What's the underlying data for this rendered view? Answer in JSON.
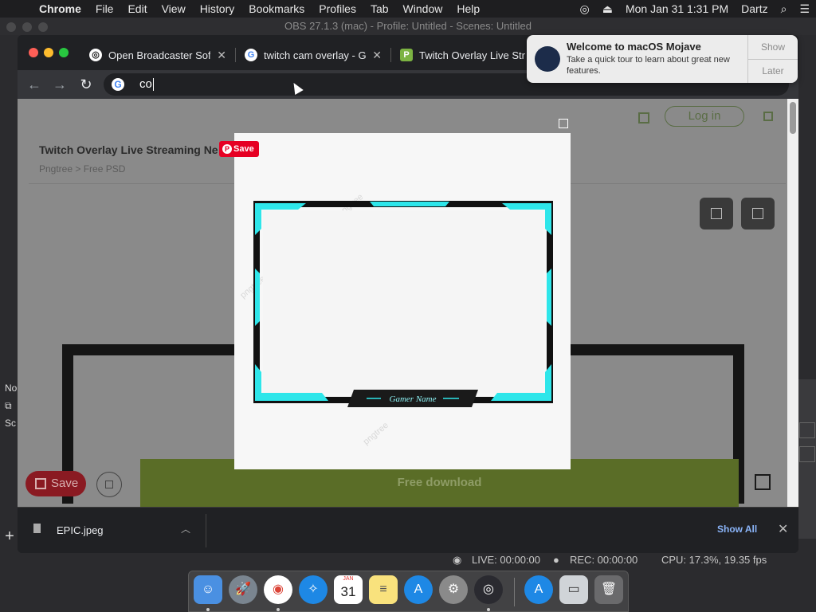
{
  "menubar": {
    "items": [
      "Chrome",
      "File",
      "Edit",
      "View",
      "History",
      "Bookmarks",
      "Profiles",
      "Tab",
      "Window",
      "Help"
    ],
    "datetime": "Mon Jan 31  1:31 PM",
    "user": "Dartz"
  },
  "obs": {
    "window_title": "OBS 27.1.3 (mac) - Profile: Untitled - Scenes: Untitled",
    "side_labels": [
      "No",
      "",
      "Sc"
    ],
    "live": "LIVE: 00:00:00",
    "rec": "REC: 00:00:00",
    "cpu": "CPU: 17.3%, 19.35 fps"
  },
  "chrome": {
    "tabs": [
      {
        "title": "Open Broadcaster Soft",
        "favicon": "obs-icon"
      },
      {
        "title": "twitch cam overlay - G",
        "favicon": "google-icon"
      },
      {
        "title": "Twitch Overlay Live Str",
        "favicon": "pngtree-icon"
      }
    ],
    "address_value": "co"
  },
  "page": {
    "title": "Twitch Overlay Live Streaming Ne",
    "breadcrumb": "Pngtree > Free PSD",
    "login_label": "Log in",
    "save_label": "Save",
    "free_download_label": "Free download"
  },
  "lightbox": {
    "pin_save_label": "Save",
    "gamer_name": "Gamer Name",
    "watermark": "pngtree"
  },
  "downloads": {
    "file_name": "EPIC.jpeg",
    "show_all_label": "Show All"
  },
  "notification": {
    "title": "Welcome to macOS Mojave",
    "body": "Take a quick tour to learn about great new features.",
    "show_label": "Show",
    "later_label": "Later"
  },
  "dock": {
    "calendar_month": "JAN",
    "calendar_day": "31",
    "items": [
      "finder-icon",
      "launchpad-icon",
      "chrome-icon",
      "safari-icon",
      "calendar-icon",
      "notes-icon",
      "app-store-icon",
      "system-preferences-icon",
      "obs-icon",
      "app-store-downloads-icon",
      "screen-icon",
      "trash-icon"
    ]
  },
  "colors": {
    "overlay_cyan": "#2ee6ea",
    "overlay_black": "#111111",
    "free_download_green": "#5a6d27",
    "pinterest_red": "#e60023"
  }
}
